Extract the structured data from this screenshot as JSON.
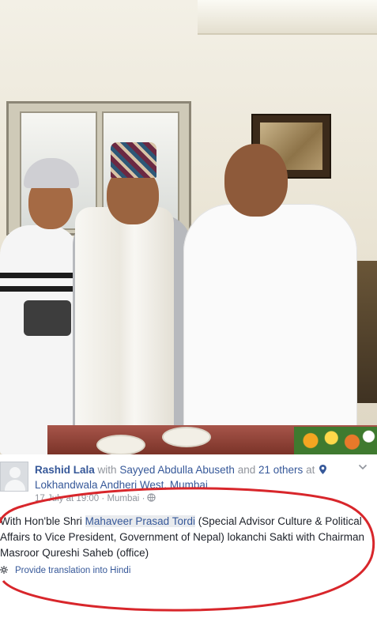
{
  "post": {
    "author": "Rashid Lala",
    "with_word": "with",
    "tagged_person": "Sayyed Abdulla Abuseth",
    "and_word": "and",
    "others": "21 others",
    "at_word": "at",
    "location": "Lokhandwala Andheri West, Mumbai.",
    "date": "17 July at 19:00",
    "separator": "·",
    "place": "Mumbai",
    "text_before": "With Hon'ble Shri ",
    "text_tag": "Mahaveer Prasad Tordi",
    "text_after": " (Special Advisor Culture & Political Affairs to Vice President, Government of Nepal) lokanchi Sakti with Chairman Masroor Qureshi Saheb (office)",
    "translate_label": "Provide translation into Hindi"
  },
  "icons": {
    "location": "map-pin-icon",
    "privacy": "globe-icon",
    "options": "chevron-down-icon",
    "translate": "gear-icon"
  },
  "colors": {
    "link": "#365899",
    "meta": "#90949c",
    "body_text": "#1d2129",
    "annotation_circle": "#d8262b"
  }
}
